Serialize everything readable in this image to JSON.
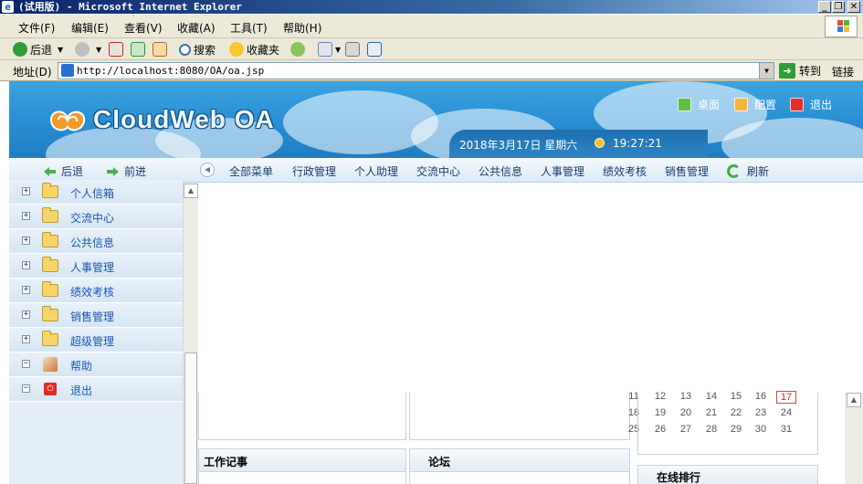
{
  "window": {
    "title": "(试用版) - Microsoft Internet Explorer",
    "controls": [
      "_",
      "❐",
      "✕"
    ]
  },
  "menubar": {
    "items": [
      "文件(F)",
      "编辑(E)",
      "查看(V)",
      "收藏(A)",
      "工具(T)",
      "帮助(H)"
    ]
  },
  "toolbar": {
    "back": "后退",
    "search": "搜索",
    "favorites": "收藏夹"
  },
  "address": {
    "label": "地址(D)",
    "url": "http://localhost:8080/OA/oa.jsp",
    "go": "转到",
    "links": "链接"
  },
  "oa": {
    "logo": "CloudWeb OA",
    "header_links": {
      "desktop": "桌面",
      "config": "配置",
      "logout": "退出"
    },
    "date": "2018年3月17日  星期六",
    "time": "19:27:21",
    "nav": {
      "back": "后退",
      "forward": "前进",
      "items": [
        "全部菜单",
        "行政管理",
        "个人助理",
        "交流中心",
        "公共信息",
        "人事管理",
        "绩效考核",
        "销售管理"
      ],
      "refresh": "刷新"
    },
    "sidebar": [
      {
        "label": "个人信箱",
        "icon": "folder-icon"
      },
      {
        "label": "交流中心",
        "icon": "folder-icon"
      },
      {
        "label": "公共信息",
        "icon": "folder-icon"
      },
      {
        "label": "人事管理",
        "icon": "folder-icon"
      },
      {
        "label": "绩效考核",
        "icon": "folder-icon"
      },
      {
        "label": "销售管理",
        "icon": "folder-icon"
      },
      {
        "label": "超级管理",
        "icon": "folder-icon"
      },
      {
        "label": "帮助",
        "icon": "help-icon"
      },
      {
        "label": "退出",
        "icon": "exit-icon"
      }
    ],
    "panels": {
      "work_notes": "工作记事",
      "forum": "论坛",
      "online_rank": "在线排行"
    },
    "calendar": {
      "rows": [
        [
          "11",
          "12",
          "13",
          "14",
          "15",
          "16",
          "17"
        ],
        [
          "18",
          "19",
          "20",
          "21",
          "22",
          "23",
          "24"
        ],
        [
          "25",
          "26",
          "27",
          "28",
          "29",
          "30",
          "31"
        ]
      ],
      "today": "17"
    }
  },
  "colors": {
    "header_blue": "#2a8fd4",
    "sidebar_bg": "#e4eef8",
    "sidebar_link": "#1b56b3",
    "nav_text": "#1a3d6b",
    "today_red": "#d22222"
  }
}
